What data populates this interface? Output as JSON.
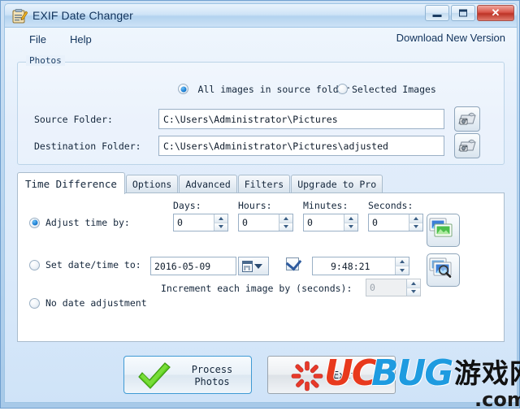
{
  "window": {
    "title": "EXIF Date Changer",
    "app_icon": "clipboard-pencil-icon",
    "minimize_label": "Minimize",
    "maximize_label": "Maximize",
    "close_label": "✕"
  },
  "menubar": {
    "file": "File",
    "help": "Help",
    "download": "Download New Version"
  },
  "photos_group": {
    "legend": "Photos",
    "radio_all_label": "All images in source folder",
    "radio_all_selected": true,
    "radio_selected_label": "Selected Images",
    "radio_selected_selected": false,
    "source_label": "Source Folder:",
    "source_value": "C:\\Users\\Administrator\\Pictures",
    "destination_label": "Destination Folder:",
    "destination_value": "C:\\Users\\Administrator\\Pictures\\adjusted",
    "browse_icon": "folder-camera-icon"
  },
  "tabs": [
    {
      "label": "Time Difference",
      "active": true
    },
    {
      "label": "Options",
      "active": false
    },
    {
      "label": "Advanced",
      "active": false
    },
    {
      "label": "Filters",
      "active": false
    },
    {
      "label": "Upgrade to Pro",
      "active": false
    }
  ],
  "time_difference": {
    "adjust_label": "Adjust time by:",
    "adjust_selected": true,
    "days_label": "Days:",
    "days_value": "0",
    "hours_label": "Hours:",
    "hours_value": "0",
    "minutes_label": "Minutes:",
    "minutes_value": "0",
    "seconds_label": "Seconds:",
    "seconds_value": "0",
    "apply_icon": "photos-apply-icon",
    "preview_icon": "photos-preview-icon",
    "setdt_label": "Set date/time to:",
    "setdt_selected": false,
    "date_value": "2016-05-09",
    "calendar_icon": "calendar-icon",
    "dropdown_icon": "chevron-down-icon",
    "time_checkbox_checked": true,
    "time_value": "9:48:21",
    "increment_label": "Increment each image by (seconds):",
    "increment_value": "0",
    "nodate_label": "No date adjustment",
    "nodate_selected": false
  },
  "footer": {
    "process_label_line1": "Process",
    "process_label_line2": "Photos",
    "process_icon": "green-check-icon",
    "exit_label": "Exit",
    "exit_icon": "red-burst-icon"
  },
  "watermark": {
    "uc": "UC",
    "bug": "BUG",
    "cn": "游戏网",
    "com": ".com"
  },
  "colors": {
    "title_accent": "#11335c",
    "close_red": "#bc3326",
    "radio_blue": "#1b7fd4",
    "process_border": "#3f9ad4",
    "wm_red": "#e8391d",
    "wm_blue": "#1e9be0"
  }
}
